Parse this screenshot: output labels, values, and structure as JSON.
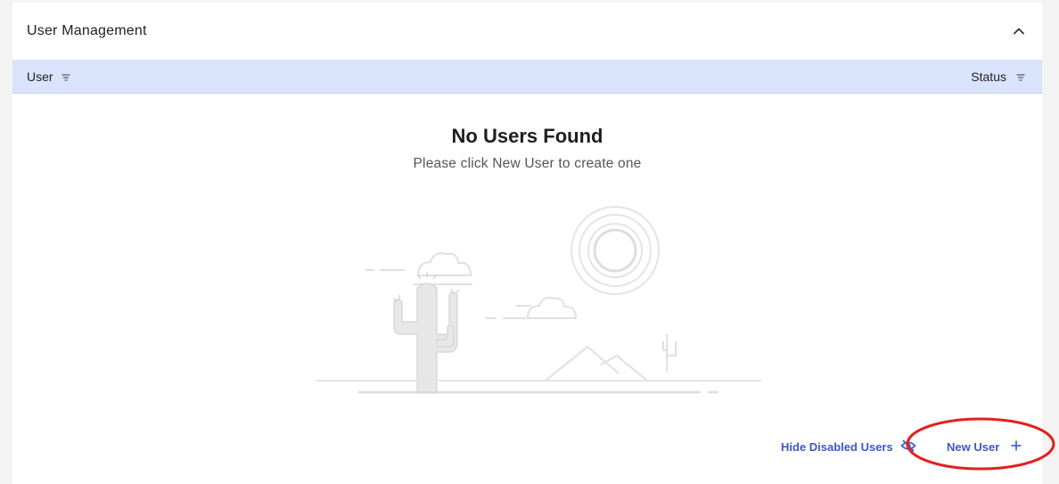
{
  "panel": {
    "title": "User Management",
    "collapse_icon": "chevron-up-icon"
  },
  "table": {
    "columns": [
      {
        "label": "User",
        "icon": "filter-icon"
      },
      {
        "label": "Status",
        "icon": "filter-icon"
      }
    ]
  },
  "empty_state": {
    "title": "No Users Found",
    "subtitle": "Please click New User to create one",
    "illustration": "desert-cactus-illustration"
  },
  "actions": {
    "hide_disabled_label": "Hide Disabled Users",
    "hide_disabled_icon": "eye-hidden-icon",
    "new_user_label": "New User",
    "new_user_icon": "plus-icon"
  },
  "colors": {
    "accent": "#3f57c7",
    "header_bg": "#d9e3fb",
    "annotation": "#e3201b"
  }
}
